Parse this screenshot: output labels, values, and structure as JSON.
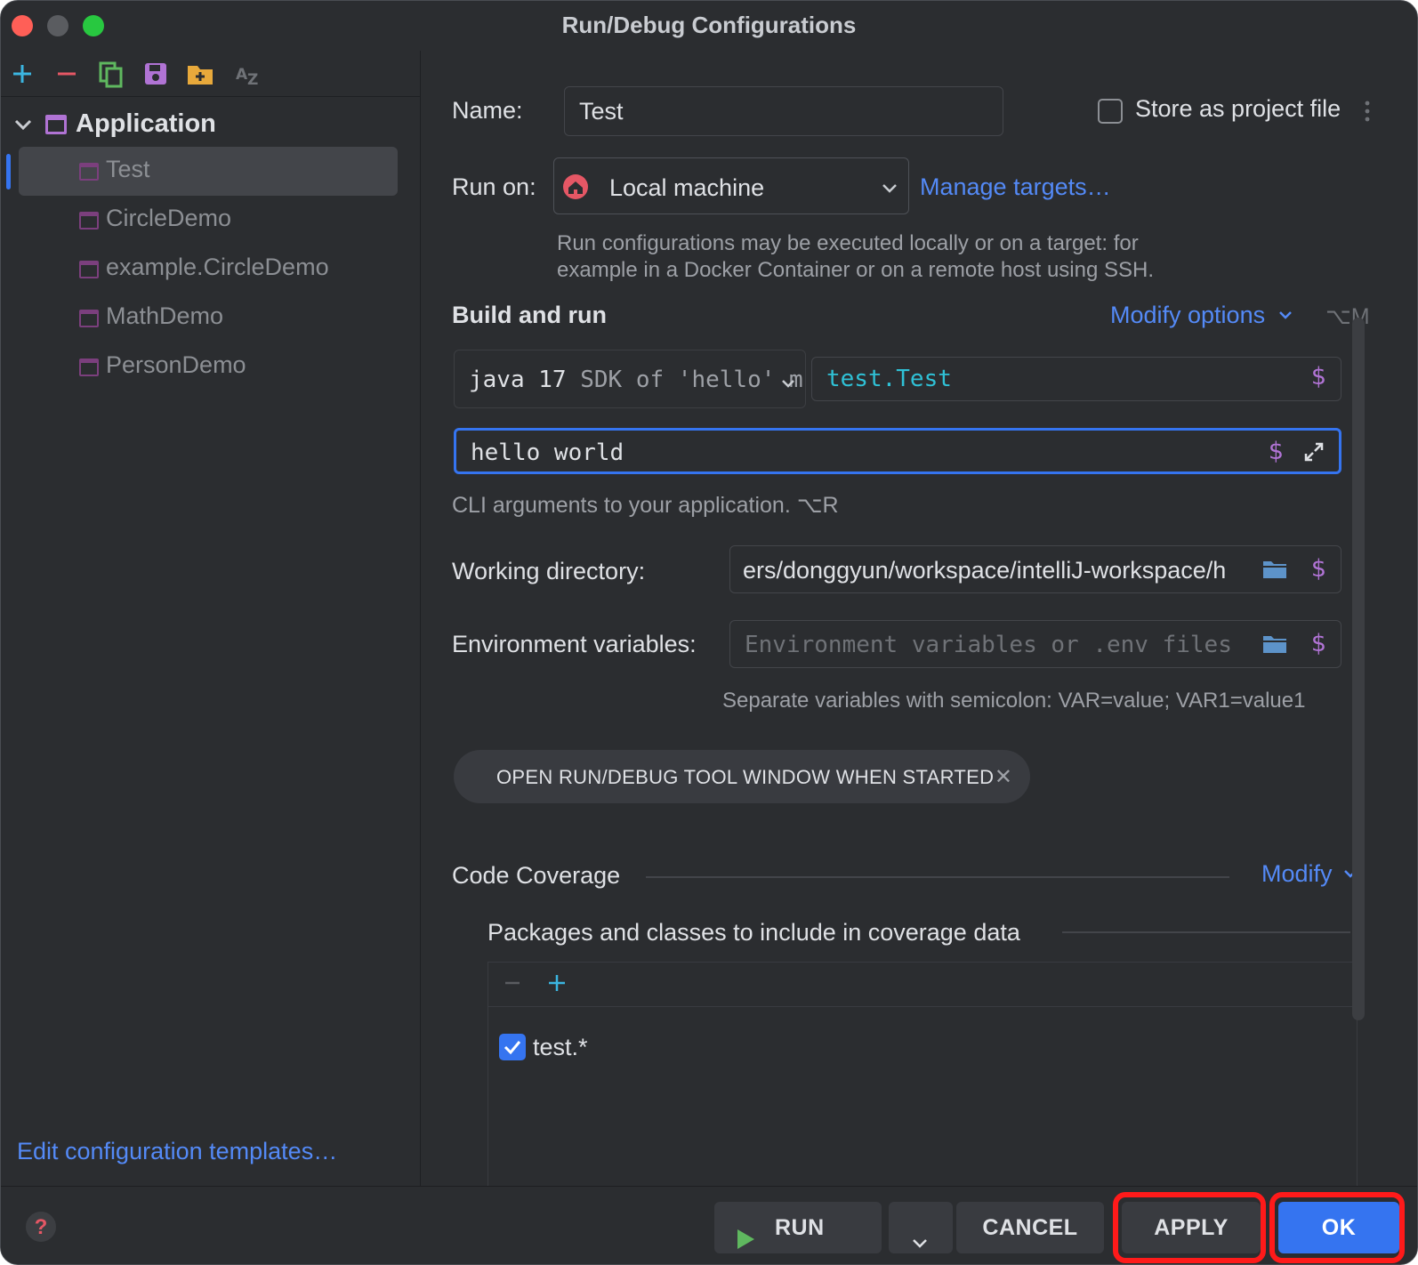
{
  "window": {
    "title": "Run/Debug Configurations"
  },
  "toolbar": {
    "icons": [
      "add-icon",
      "remove-icon",
      "copy-icon",
      "save-icon",
      "new-folder-icon",
      "sort-alphabetically-icon"
    ]
  },
  "tree": {
    "root_label": "Application",
    "items": [
      {
        "label": "Test",
        "selected": true
      },
      {
        "label": "CircleDemo"
      },
      {
        "label": "example.CircleDemo"
      },
      {
        "label": "MathDemo"
      },
      {
        "label": "PersonDemo"
      }
    ]
  },
  "edit_templates_label": "Edit configuration templates…",
  "form": {
    "name_label": "Name:",
    "name_value": "Test",
    "store_label": "Store as project file",
    "run_on_label": "Run on:",
    "run_on_value": "Local machine",
    "manage_targets": "Manage targets…",
    "run_on_hint_line1": "Run configurations may be executed locally or on a target: for",
    "run_on_hint_line2": "example in a Docker Container or on a remote host using SSH.",
    "build_run_title": "Build and run",
    "modify_options": "Modify options",
    "modify_options_shortcut": "⌥M",
    "sdk_main": "java 17",
    "sdk_detail": "SDK of 'hello' m",
    "main_class": "test.Test",
    "program_args": "hello world",
    "program_args_hint": "CLI arguments to your application. ⌥R",
    "working_dir_label": "Working directory:",
    "working_dir_value": "ers/donggyun/workspace/intelliJ-workspace/h",
    "env_label": "Environment variables:",
    "env_placeholder": "Environment variables or .env files",
    "env_hint": "Separate variables with semicolon: VAR=value; VAR1=value1",
    "chip_label": "OPEN RUN/DEBUG TOOL WINDOW WHEN STARTED",
    "coverage_title": "Code Coverage",
    "coverage_modify": "Modify",
    "coverage_packages_title": "Packages and classes to include in coverage data",
    "coverage_entry": "test.*",
    "dollar": "$"
  },
  "buttons": {
    "run": "RUN",
    "cancel": "CANCEL",
    "apply": "APPLY",
    "ok": "OK"
  },
  "colors": {
    "background": "#2b2d30",
    "accent": "#3574f0",
    "link": "#548af7",
    "highlight": "#ff1a1a"
  }
}
